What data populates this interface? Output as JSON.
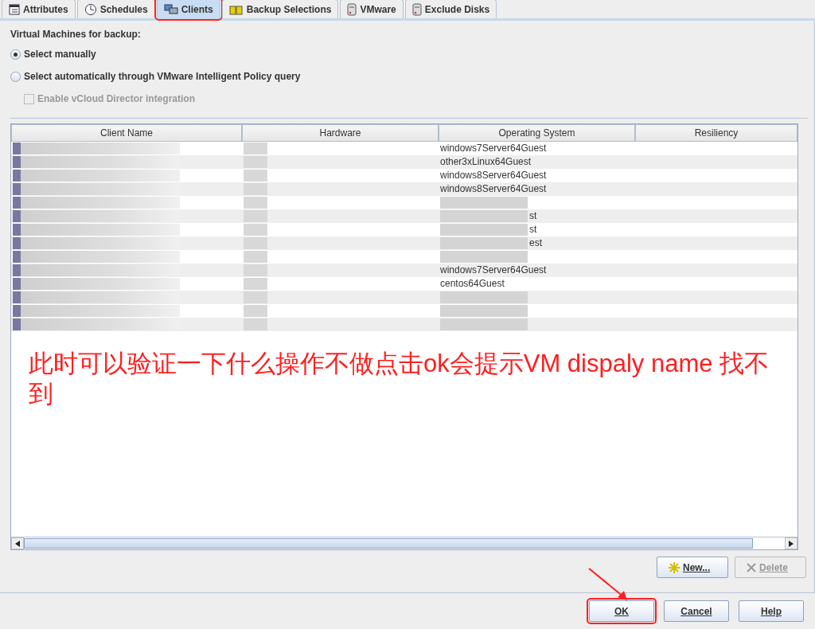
{
  "tabs": [
    {
      "label": "Attributes",
      "selected": false,
      "highlighted": false
    },
    {
      "label": "Schedules",
      "selected": false,
      "highlighted": false
    },
    {
      "label": "Clients",
      "selected": true,
      "highlighted": true
    },
    {
      "label": "Backup Selections",
      "selected": false,
      "highlighted": false
    },
    {
      "label": "VMware",
      "selected": false,
      "highlighted": false
    },
    {
      "label": "Exclude Disks",
      "selected": false,
      "highlighted": false
    }
  ],
  "section_label": "Virtual Machines for backup:",
  "options": [
    {
      "kind": "radio",
      "label": "Select manually",
      "selected": true,
      "disabled": false
    },
    {
      "kind": "radio",
      "label": "Select automatically through VMware Intelligent Policy query",
      "selected": false,
      "disabled": false
    },
    {
      "kind": "checkbox",
      "label": "Enable vCloud Director integration",
      "checked": false,
      "disabled": true
    }
  ],
  "table": {
    "columns": [
      "Client Name",
      "Hardware",
      "Operating System",
      "Resiliency"
    ],
    "rows": [
      {
        "os": "windows7Server64Guest",
        "blurred": true
      },
      {
        "os": "other3xLinux64Guest",
        "blurred": true
      },
      {
        "os": "windows8Server64Guest",
        "blurred": true
      },
      {
        "os": "windows8Server64Guest",
        "blurred": true
      },
      {
        "blurred": true
      },
      {
        "os": "st",
        "blurred": true
      },
      {
        "os": "st",
        "blurred": true
      },
      {
        "os": "est",
        "blurred": true
      },
      {
        "blurred": true
      },
      {
        "os": "windows7Server64Guest",
        "blurred": true
      },
      {
        "os": "centos64Guest",
        "blurred": true
      },
      {
        "blurred": true
      },
      {
        "blurred": true
      },
      {
        "blurred": true
      }
    ]
  },
  "annotation": {
    "text": "此时可以验证一下什么操作不做点击ok会提示VM dispaly name 找不到"
  },
  "table_buttons": [
    {
      "label": "New...",
      "disabled": false
    },
    {
      "label": "Delete",
      "disabled": true
    }
  ],
  "dialog_buttons": [
    {
      "label": "OK",
      "highlighted": true
    },
    {
      "label": "Cancel",
      "highlighted": false
    },
    {
      "label": "Help",
      "highlighted": false
    }
  ]
}
